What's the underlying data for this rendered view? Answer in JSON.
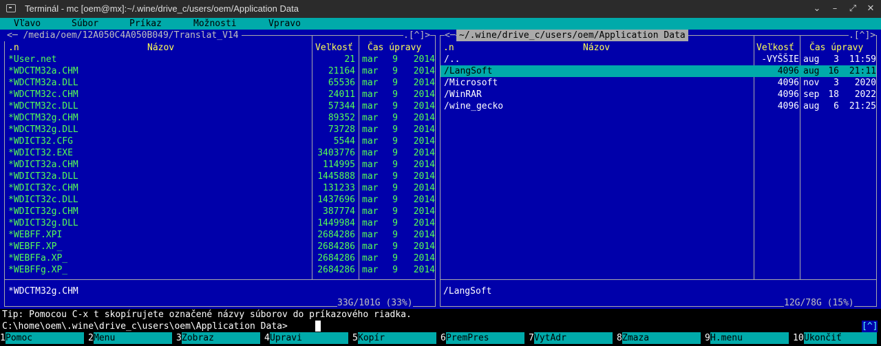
{
  "window": {
    "title": "Terminál - mc [oem@mx]:~/.wine/drive_c/users/oem/Application Data",
    "buttons": [
      "⌄",
      "–",
      "⤢",
      "✕"
    ]
  },
  "menubar": [
    "Vľavo",
    "Súbor",
    "Príkaz",
    "Možnosti",
    "Vpravo"
  ],
  "left_panel": {
    "path": "<─ /media/oem/12A050C4A050B049/Translat_V14",
    "corner": ".[^]>",
    "headers": {
      "name_col": ".n",
      "name": "Názov",
      "size": "Veľkosť",
      "time": "Čas úpravy"
    },
    "rows": [
      {
        "name": "*User.net",
        "size": "21",
        "mon": "mar",
        "day": "9",
        "time": "2014"
      },
      {
        "name": "*WDCTM32a.CHM",
        "size": "21164",
        "mon": "mar",
        "day": "9",
        "time": "2014"
      },
      {
        "name": "*WDCTM32a.DLL",
        "size": "65536",
        "mon": "mar",
        "day": "9",
        "time": "2014"
      },
      {
        "name": "*WDCTM32c.CHM",
        "size": "24011",
        "mon": "mar",
        "day": "9",
        "time": "2014"
      },
      {
        "name": "*WDCTM32c.DLL",
        "size": "57344",
        "mon": "mar",
        "day": "9",
        "time": "2014"
      },
      {
        "name": "*WDCTM32g.CHM",
        "size": "89352",
        "mon": "mar",
        "day": "9",
        "time": "2014"
      },
      {
        "name": "*WDCTM32g.DLL",
        "size": "73728",
        "mon": "mar",
        "day": "9",
        "time": "2014"
      },
      {
        "name": "*WDICT32.CFG",
        "size": "5544",
        "mon": "mar",
        "day": "9",
        "time": "2014"
      },
      {
        "name": "*WDICT32.EXE",
        "size": "3403776",
        "mon": "mar",
        "day": "9",
        "time": "2014"
      },
      {
        "name": "*WDICT32a.CHM",
        "size": "114995",
        "mon": "mar",
        "day": "9",
        "time": "2014"
      },
      {
        "name": "*WDICT32a.DLL",
        "size": "1445888",
        "mon": "mar",
        "day": "9",
        "time": "2014"
      },
      {
        "name": "*WDICT32c.CHM",
        "size": "131233",
        "mon": "mar",
        "day": "9",
        "time": "2014"
      },
      {
        "name": "*WDICT32c.DLL",
        "size": "1437696",
        "mon": "mar",
        "day": "9",
        "time": "2014"
      },
      {
        "name": "*WDICT32g.CHM",
        "size": "387774",
        "mon": "mar",
        "day": "9",
        "time": "2014"
      },
      {
        "name": "*WDICT32g.DLL",
        "size": "1449984",
        "mon": "mar",
        "day": "9",
        "time": "2014"
      },
      {
        "name": "*WEBFF.XPI",
        "size": "2684286",
        "mon": "mar",
        "day": "9",
        "time": "2014"
      },
      {
        "name": "*WEBFF.XP_",
        "size": "2684286",
        "mon": "mar",
        "day": "9",
        "time": "2014"
      },
      {
        "name": "*WEBFFa.XP_",
        "size": "2684286",
        "mon": "mar",
        "day": "9",
        "time": "2014"
      },
      {
        "name": "*WEBFFg.XP_",
        "size": "2684286",
        "mon": "mar",
        "day": "9",
        "time": "2014"
      }
    ],
    "status": "*WDCTM32g.CHM",
    "footer": "33G/101G (33%)"
  },
  "right_panel": {
    "path": "~/.wine/drive_c/users/oem/Application Data",
    "corner": ".[^]>",
    "headers": {
      "name_col": ".n",
      "name": "Názov",
      "size": "Veľkosť",
      "time": "Čas úpravy"
    },
    "rows": [
      {
        "name": "/..",
        "size": "-VYŠŠIE",
        "mon": "aug",
        "day": "3",
        "time": "11:59",
        "highlight": false
      },
      {
        "name": "/LangSoft",
        "size": "4096",
        "mon": "aug",
        "day": "16",
        "time": "21:11",
        "highlight": true
      },
      {
        "name": "/Microsoft",
        "size": "4096",
        "mon": "nov",
        "day": "3",
        "time": "2020",
        "highlight": false
      },
      {
        "name": "/WinRAR",
        "size": "4096",
        "mon": "sep",
        "day": "18",
        "time": "2022",
        "highlight": false
      },
      {
        "name": "/wine_gecko",
        "size": "4096",
        "mon": "aug",
        "day": "6",
        "time": "21:25",
        "highlight": false
      }
    ],
    "status": "/LangSoft",
    "footer": "12G/78G (15%)"
  },
  "tip": "Tip: Pomocou C-x t skopírujete označené názvy súborov do príkazového riadka.",
  "command_line": "C:\\home\\oem\\.wine\\drive_c\\users\\oem\\Application Data>",
  "scroll_marker": "[^]",
  "fkeys": [
    {
      "num": "1",
      "label": "Pomoc"
    },
    {
      "num": "2",
      "label": "Menu"
    },
    {
      "num": "3",
      "label": "Zobraz"
    },
    {
      "num": "4",
      "label": "Upravi"
    },
    {
      "num": "5",
      "label": "Kopír"
    },
    {
      "num": "6",
      "label": "PremPres"
    },
    {
      "num": "7",
      "label": "VytAdr"
    },
    {
      "num": "8",
      "label": "Zmaza"
    },
    {
      "num": "9",
      "label": "H.menu"
    },
    {
      "num": "10",
      "label": "Ukončiť"
    }
  ]
}
